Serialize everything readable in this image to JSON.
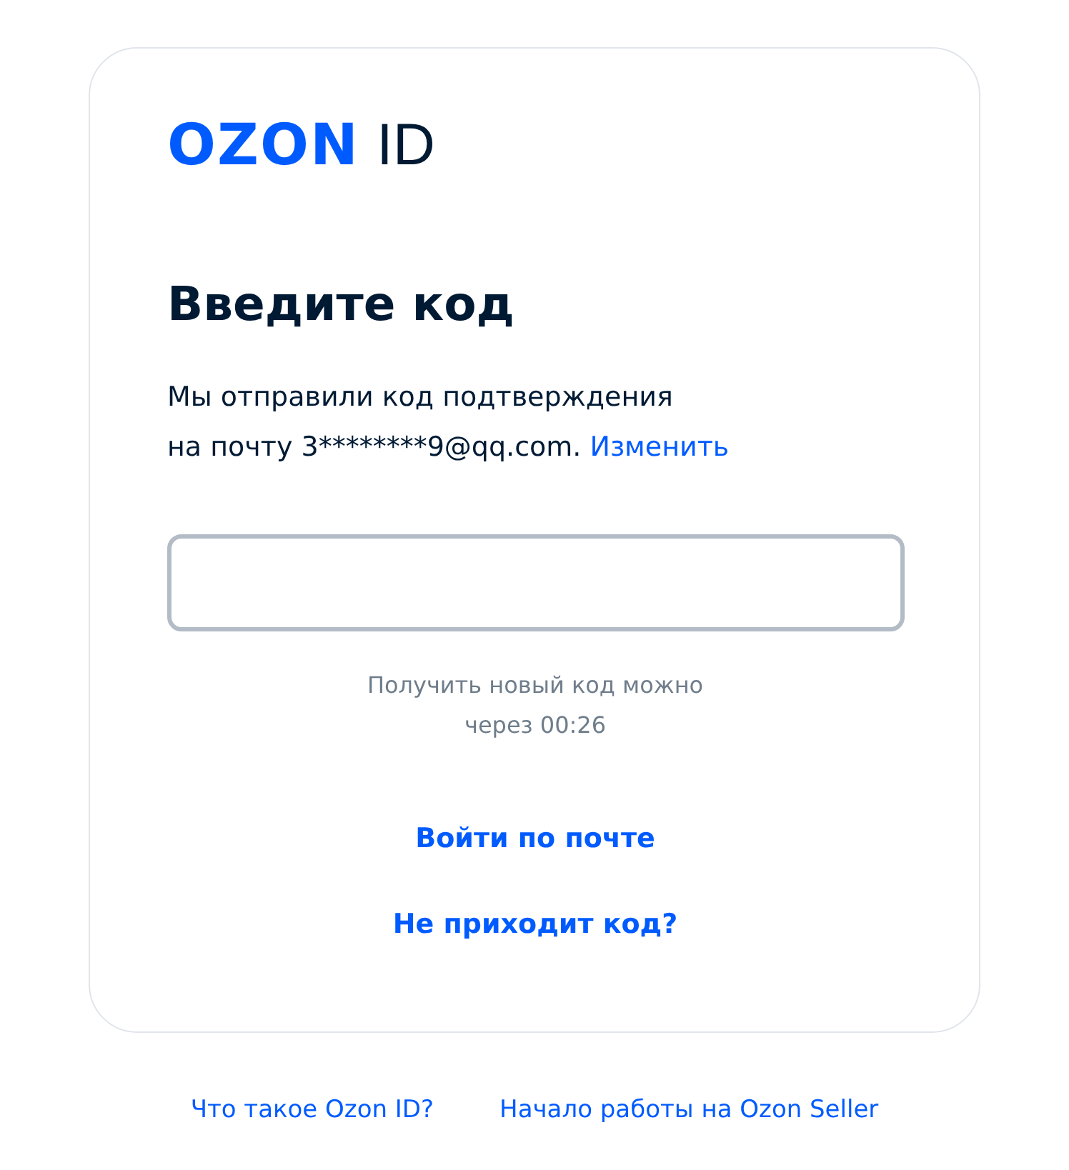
{
  "logo": {
    "brand": "OZON",
    "suffix": "ID"
  },
  "heading": "Введите код",
  "message": {
    "text": "Мы отправили код подтверждения\nна почту 3********9@qq.com.",
    "link": "Изменить"
  },
  "code_field": {
    "focused": false
  },
  "resend_note": "Получить новый код можно\nчерез 00:26",
  "actions": [
    "Войти по почте",
    "Не приходит код?"
  ],
  "footer_links": [
    "Что такое Ozon ID?",
    "Начало работы на Ozon Seller"
  ]
}
